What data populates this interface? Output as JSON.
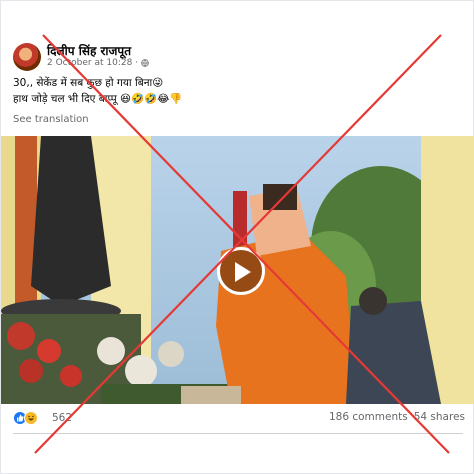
{
  "post": {
    "author": "दिलीप सिंह राजपूत",
    "timestamp": "2 October at 10:28 ·",
    "audience_icon": "globe-icon",
    "text_line1": "30,, सेकेंड में सब कुछ हो गया बिना😜",
    "text_line2": "हाथ जोड़े चल भी दिए बाप्पू 😆🤣🤣😂👎",
    "see_translation": "See translation"
  },
  "video": {
    "play_icon": "play-icon"
  },
  "footer": {
    "reaction_icons": [
      "like-icon",
      "haha-icon"
    ],
    "reaction_count": "562",
    "comments": "186 comments",
    "shares": "54 shares"
  },
  "overlay": {
    "cross_color": "#e53935",
    "brand_blue": "#1877f2"
  }
}
